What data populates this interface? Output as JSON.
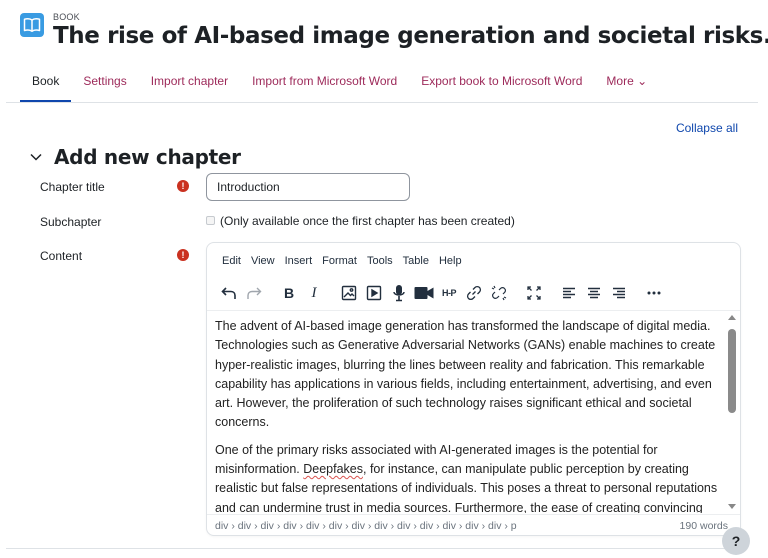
{
  "header": {
    "module_label": "BOOK",
    "title": "The rise of AI-based image generation and societal risks.",
    "icon": "book-open-icon",
    "icon_color": "#399be2"
  },
  "tabs": [
    {
      "label": "Book",
      "active": true
    },
    {
      "label": "Settings",
      "active": false
    },
    {
      "label": "Import chapter",
      "active": false
    },
    {
      "label": "Import from Microsoft Word",
      "active": false
    },
    {
      "label": "Export book to Microsoft Word",
      "active": false
    },
    {
      "label": "More ⌄",
      "active": false
    }
  ],
  "collapse_all": "Collapse all",
  "section": {
    "chevron": "⌄",
    "title": "Add new chapter"
  },
  "form": {
    "chapter_title": {
      "label": "Chapter title",
      "value": "Introduction",
      "required": true
    },
    "subchapter": {
      "label": "Subchapter",
      "note": "(Only available once the first chapter has been created)",
      "checked": false
    },
    "content": {
      "label": "Content",
      "required": true
    }
  },
  "editor": {
    "menus": [
      "Edit",
      "View",
      "Insert",
      "Format",
      "Tools",
      "Table",
      "Help"
    ],
    "toolbar": [
      "undo-icon",
      "redo-icon",
      "bold-icon",
      "italic-icon",
      "image-icon",
      "media-icon",
      "record-audio-icon",
      "record-video-icon",
      "h5p-icon",
      "link-icon",
      "unlink-icon",
      "fullscreen-icon",
      "align-left-icon",
      "align-center-icon",
      "align-right-icon",
      "more-icon"
    ],
    "paragraph1": "The advent of AI-based image generation has transformed the landscape of digital media. Technologies such as Generative Adversarial Networks (GANs) enable machines to create hyper-realistic images, blurring the lines between reality and fabrication. This remarkable capability has applications in various fields, including entertainment, advertising, and even art. However, the proliferation of such technology raises significant ethical and societal concerns.",
    "paragraph2_before": "One of the primary risks associated with AI-generated images is the potential for misinformation. ",
    "paragraph2_misspelled": "Deepfakes",
    "paragraph2_after": ", for instance, can manipulate public perception by creating realistic but false representations of individuals. This poses a threat to personal reputations and can undermine trust in media sources. Furthermore, the ease of creating convincing images may exacerbate existing issues related to identity theft and privacy violations.",
    "element_path": "div › div › div › div › div › div › div › div › div › div › div › div › div › p",
    "word_count": "190 words"
  },
  "help_button": "?",
  "colors": {
    "link": "#9d2a5a",
    "active_tab_underline": "#0f47ad",
    "required": "#ca3120"
  }
}
